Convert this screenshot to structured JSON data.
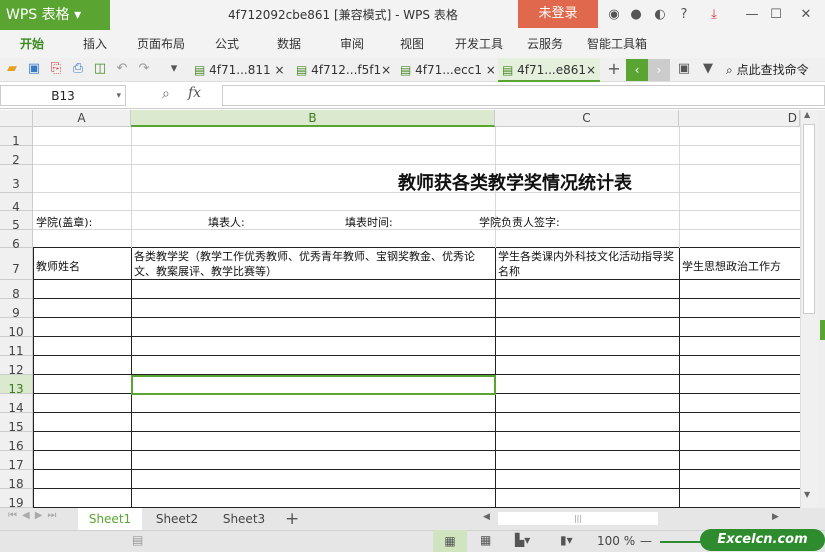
{
  "app": {
    "logo": "WPS 表格",
    "title": "4f712092cbe861 [兼容模式] - WPS 表格",
    "login": "未登录"
  },
  "menu": [
    "开始",
    "插入",
    "页面布局",
    "公式",
    "数据",
    "审阅",
    "视图",
    "开发工具",
    "云服务",
    "智能工具箱"
  ],
  "doc_tabs": [
    "4f71...811",
    "4f712...f5f1",
    "4f71...ecc1",
    "4f71...e861"
  ],
  "search_cmd": "点此查找命令",
  "name_box": "B13",
  "fx": "fx",
  "columns": [
    "A",
    "B",
    "C",
    "D"
  ],
  "rows": [
    "1",
    "2",
    "3",
    "4",
    "5",
    "6",
    "7",
    "8",
    "9",
    "10",
    "11",
    "12",
    "13",
    "14",
    "15",
    "16",
    "17",
    "18",
    "19"
  ],
  "sheet": {
    "title": "教师获各类教学奖情况统计表",
    "row5": [
      "学院(盖章):",
      "填表人:",
      "填表时间:",
      "学院负责人签字:"
    ],
    "headers": [
      "教师姓名",
      "各类教学奖（教学工作优秀教师、优秀青年教师、宝钢奖教金、优秀论文、教案展评、教学比赛等）",
      "学生各类课内外科技文化活动指导奖名称",
      "学生思想政治工作方"
    ]
  },
  "sheet_tabs": [
    "Sheet1",
    "Sheet2",
    "Sheet3"
  ],
  "status": {
    "zoom": "100 %",
    "brand": "Excelcn.com"
  },
  "colors": {
    "accent": "#5aa532",
    "login": "#e0694d"
  }
}
